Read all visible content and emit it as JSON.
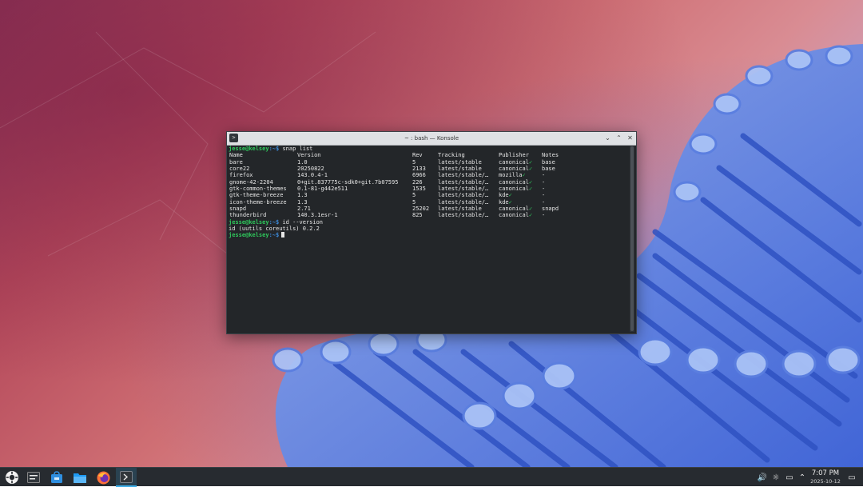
{
  "window": {
    "title": "~ : bash — Konsole",
    "app_icon_glyph": ">",
    "buttons": [
      "⌄",
      "⌃",
      "✕"
    ]
  },
  "terminal": {
    "prompt_user": "jesse@kelsey",
    "prompt_path": ":~$",
    "command1": " snap list",
    "header": [
      "Name",
      "Version",
      "Rev",
      "Tracking",
      "Publisher",
      "Notes"
    ],
    "rows": [
      {
        "name": "bare",
        "version": "1.0",
        "rev": "5",
        "tracking": "latest/stable",
        "publisher": "canonical",
        "verified": true,
        "notes": "base"
      },
      {
        "name": "core22",
        "version": "20250822",
        "rev": "2133",
        "tracking": "latest/stable",
        "publisher": "canonical",
        "verified": true,
        "notes": "base"
      },
      {
        "name": "firefox",
        "version": "143.0.4-1",
        "rev": "6966",
        "tracking": "latest/stable/…",
        "publisher": "mozilla",
        "verified": true,
        "notes": "-"
      },
      {
        "name": "gnome-42-2204",
        "version": "0+git.837775c-sdk0+git.7b07595",
        "rev": "226",
        "tracking": "latest/stable/…",
        "publisher": "canonical",
        "verified": true,
        "notes": "-"
      },
      {
        "name": "gtk-common-themes",
        "version": "0.1-81-g442e511",
        "rev": "1535",
        "tracking": "latest/stable/…",
        "publisher": "canonical",
        "verified": true,
        "notes": "-"
      },
      {
        "name": "gtk-theme-breeze",
        "version": "1.3",
        "rev": "5",
        "tracking": "latest/stable/…",
        "publisher": "kde",
        "verified": true,
        "notes": "-"
      },
      {
        "name": "icon-theme-breeze",
        "version": "1.3",
        "rev": "5",
        "tracking": "latest/stable/…",
        "publisher": "kde",
        "verified": true,
        "notes": "-"
      },
      {
        "name": "snapd",
        "version": "2.71",
        "rev": "25202",
        "tracking": "latest/stable",
        "publisher": "canonical",
        "verified": true,
        "notes": "snapd"
      },
      {
        "name": "thunderbird",
        "version": "140.3.1esr-1",
        "rev": "825",
        "tracking": "latest/stable/…",
        "publisher": "canonical",
        "verified": true,
        "notes": "-"
      }
    ],
    "verified_mark": "✓",
    "command2": " id --version",
    "output2": "id (uutils coreutils) 0.2.2"
  },
  "taskbar": {
    "launcher_icon": "kde-logo-icon",
    "apps": [
      {
        "name": "task-manager-icon",
        "active": false
      },
      {
        "name": "discover-store-icon",
        "active": false
      },
      {
        "name": "dolphin-files-icon",
        "active": false
      },
      {
        "name": "firefox-icon",
        "active": false
      },
      {
        "name": "konsole-icon",
        "active": true
      }
    ],
    "tray": {
      "volume_icon": "🔊",
      "brightness_icon": "☼",
      "network_icon": "▭",
      "expand_icon": "⌃"
    },
    "clock_time": "7:07 PM",
    "clock_date": "2025-10-12",
    "show_desktop_icon": "▭"
  },
  "colors": {
    "terminal_bg": "#232629",
    "prompt_green": "#2fca5c",
    "prompt_blue": "#3c8cdc",
    "taskbar_bg": "#272b30",
    "accent": "#3daee9"
  }
}
